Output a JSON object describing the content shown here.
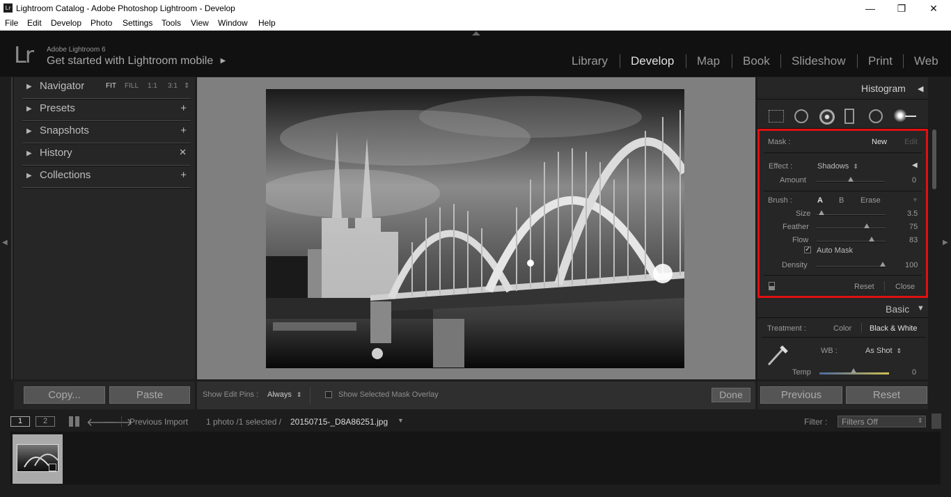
{
  "window": {
    "title": "Lightroom Catalog - Adobe Photoshop Lightroom - Develop",
    "app_icon": "Lr",
    "minimize": "—",
    "restore": "❐",
    "close": "✕"
  },
  "menu": [
    "File",
    "Edit",
    "Develop",
    "Photo",
    "Settings",
    "Tools",
    "View",
    "Window",
    "Help"
  ],
  "identity": {
    "logo": "Lr",
    "version": "Adobe Lightroom 6",
    "mobile_prompt": "Get started with Lightroom mobile",
    "mobile_arrow": "▶"
  },
  "modules": [
    "Library",
    "Develop",
    "Map",
    "Book",
    "Slideshow",
    "Print",
    "Web"
  ],
  "active_module": "Develop",
  "left_panel": {
    "navigator": {
      "label": "Navigator",
      "options": [
        "FIT",
        "FILL",
        "1:1",
        "3:1"
      ],
      "stepper": "⇕"
    },
    "presets": {
      "label": "Presets",
      "action": "+"
    },
    "snapshots": {
      "label": "Snapshots",
      "action": "+"
    },
    "history": {
      "label": "History",
      "action": "✕"
    },
    "collections": {
      "label": "Collections",
      "action": "+"
    }
  },
  "left_toolbar": {
    "copy": "Copy...",
    "paste": "Paste"
  },
  "center_toolbar": {
    "pins_label": "Show Edit Pins :",
    "pins_value": "Always",
    "overlay_label": "Show Selected Mask Overlay",
    "done": "Done"
  },
  "right_panel": {
    "histogram": "Histogram",
    "histogram_arrow": "◀",
    "mask_label": "Mask :",
    "mask_new": "New",
    "mask_edit": "Edit",
    "effect_label": "Effect :",
    "effect_value": "Shadows",
    "amount_label": "Amount",
    "amount_value": "0",
    "brush_label": "Brush :",
    "brush_a": "A",
    "brush_b": "B",
    "brush_erase": "Erase",
    "size_label": "Size",
    "size_value": "3.5",
    "feather_label": "Feather",
    "feather_value": "75",
    "flow_label": "Flow",
    "flow_value": "83",
    "automask_label": "Auto Mask",
    "automask_checked": true,
    "density_label": "Density",
    "density_value": "100",
    "reset": "Reset",
    "close": "Close",
    "basic": "Basic",
    "basic_arrow": "▼",
    "treatment_label": "Treatment :",
    "treatment_color": "Color",
    "treatment_bw": "Black & White",
    "wb_label": "WB :",
    "wb_value": "As Shot",
    "temp_label": "Temp",
    "temp_value": "0",
    "highlight_color": "#e01010",
    "slider_levels": {
      "amount": 0.5,
      "size": 0.08,
      "feather": 0.73,
      "flow": 0.8,
      "density": 0.96,
      "temp": 0.49
    }
  },
  "right_toolbar": {
    "previous": "Previous",
    "reset": "Reset"
  },
  "filmstrip": {
    "view1": "1",
    "view2": "2",
    "source": "Previous Import",
    "count": "1 photo /1 selected /",
    "filename": "20150715-_D8A86251.jpg",
    "filter_label": "Filter :",
    "filter_value": "Filters Off"
  }
}
